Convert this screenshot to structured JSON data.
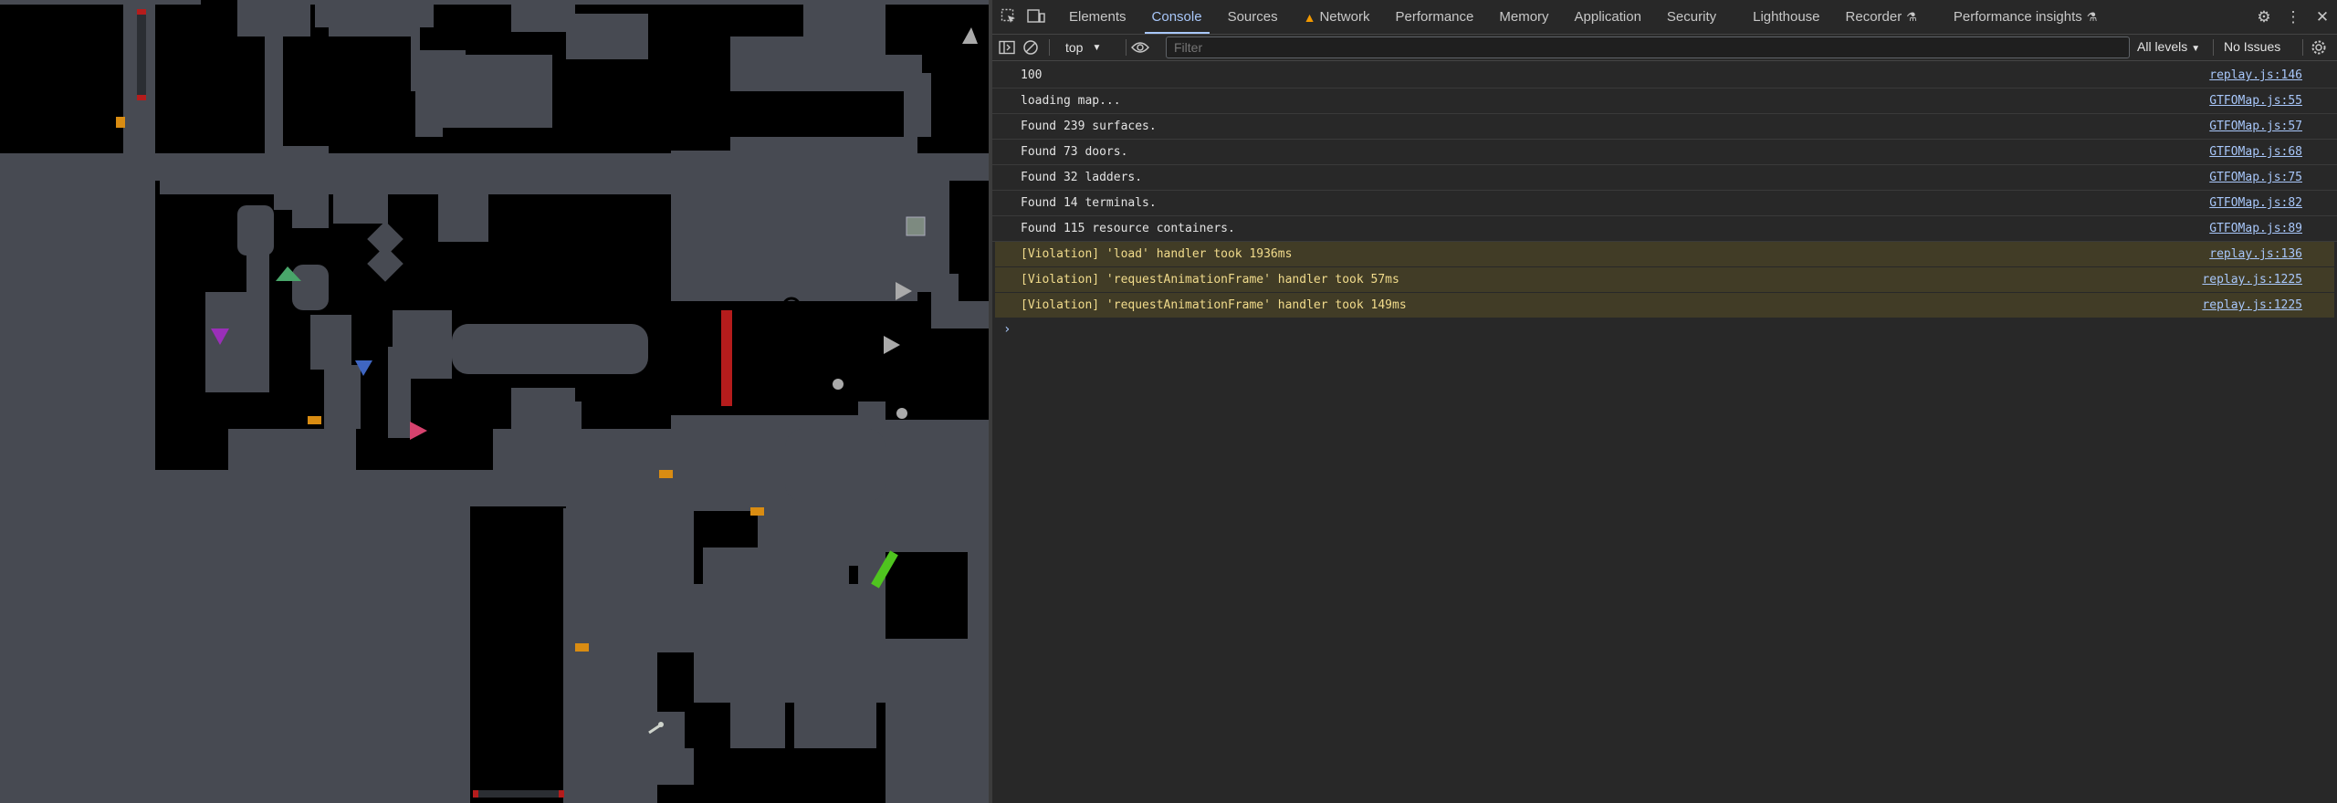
{
  "map": {
    "background": "#000000",
    "floor": "#474a52",
    "door_red": "#b51c1c",
    "item_orange": "#d98c12",
    "bridge_green": "#4fc41f"
  },
  "devtools": {
    "tabs": [
      {
        "label": "Elements"
      },
      {
        "label": "Console",
        "active": true
      },
      {
        "label": "Sources"
      },
      {
        "label": "Network",
        "warning": true
      },
      {
        "label": "Performance"
      },
      {
        "label": "Memory"
      },
      {
        "label": "Application"
      },
      {
        "label": "Security"
      },
      {
        "label": "Lighthouse"
      },
      {
        "label": "Recorder",
        "experimental": true
      },
      {
        "label": "Performance insights",
        "experimental": true
      }
    ],
    "toolbar": {
      "context": "top",
      "filter_placeholder": "Filter",
      "levels": "All levels",
      "issues": "No Issues"
    },
    "accent": "#a8c7fa",
    "warning_bg": "#413c26",
    "warning_text": "#f2dc8c"
  },
  "console": {
    "messages": [
      {
        "text": "100",
        "source": "replay.js:146",
        "type": "log"
      },
      {
        "text": "loading map...",
        "source": "GTFOMap.js:55",
        "type": "log"
      },
      {
        "text": "Found 239 surfaces.",
        "source": "GTFOMap.js:57",
        "type": "log"
      },
      {
        "text": "Found 73 doors.",
        "source": "GTFOMap.js:68",
        "type": "log"
      },
      {
        "text": "Found 32 ladders.",
        "source": "GTFOMap.js:75",
        "type": "log"
      },
      {
        "text": "Found 14 terminals.",
        "source": "GTFOMap.js:82",
        "type": "log"
      },
      {
        "text": "Found 115 resource containers.",
        "source": "GTFOMap.js:89",
        "type": "log"
      },
      {
        "text": "[Violation] 'load' handler took 1936ms",
        "source": "replay.js:136",
        "type": "violation"
      },
      {
        "text": "[Violation] 'requestAnimationFrame' handler took 57ms",
        "source": "replay.js:1225",
        "type": "violation"
      },
      {
        "text": "[Violation] 'requestAnimationFrame' handler took 149ms",
        "source": "replay.js:1225",
        "type": "violation"
      }
    ],
    "prompt": "›"
  }
}
